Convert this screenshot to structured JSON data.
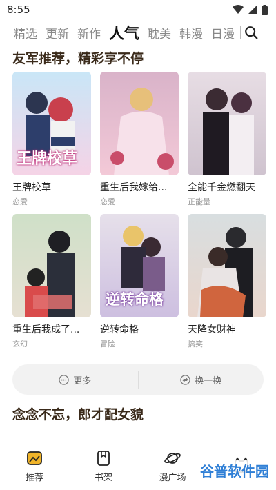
{
  "status": {
    "time": "8:55"
  },
  "tabs": [
    {
      "label": "精选"
    },
    {
      "label": "更新"
    },
    {
      "label": "新作"
    },
    {
      "label": "人气"
    },
    {
      "label": "耽美"
    },
    {
      "label": "韩漫"
    },
    {
      "label": "日漫"
    }
  ],
  "sections": {
    "first_title": "友军推荐，精彩享不停",
    "second_title": "念念不忘，郎才配女貌"
  },
  "comics": [
    {
      "title": "王牌校草",
      "tag": "恋爱",
      "cover_text": "王牌校草"
    },
    {
      "title": "重生后我嫁给...",
      "tag": "恋爱",
      "cover_text": ""
    },
    {
      "title": "全能千金燃翻天",
      "tag": "正能量",
      "cover_text": ""
    },
    {
      "title": "重生后我成了...",
      "tag": "玄幻",
      "cover_text": ""
    },
    {
      "title": "逆转命格",
      "tag": "冒险",
      "cover_text": "逆转命格"
    },
    {
      "title": "天降女财神",
      "tag": "搞笑",
      "cover_text": ""
    }
  ],
  "actions": {
    "more": "更多",
    "refresh": "换一换"
  },
  "nav": [
    {
      "label": "推荐"
    },
    {
      "label": "书架"
    },
    {
      "label": "漫广场"
    },
    {
      "label": ""
    }
  ],
  "watermark": "谷普软件园",
  "colors": {
    "accent": "#111111",
    "section_title": "#3a2a1a",
    "watermark": "#2f7fd6"
  }
}
